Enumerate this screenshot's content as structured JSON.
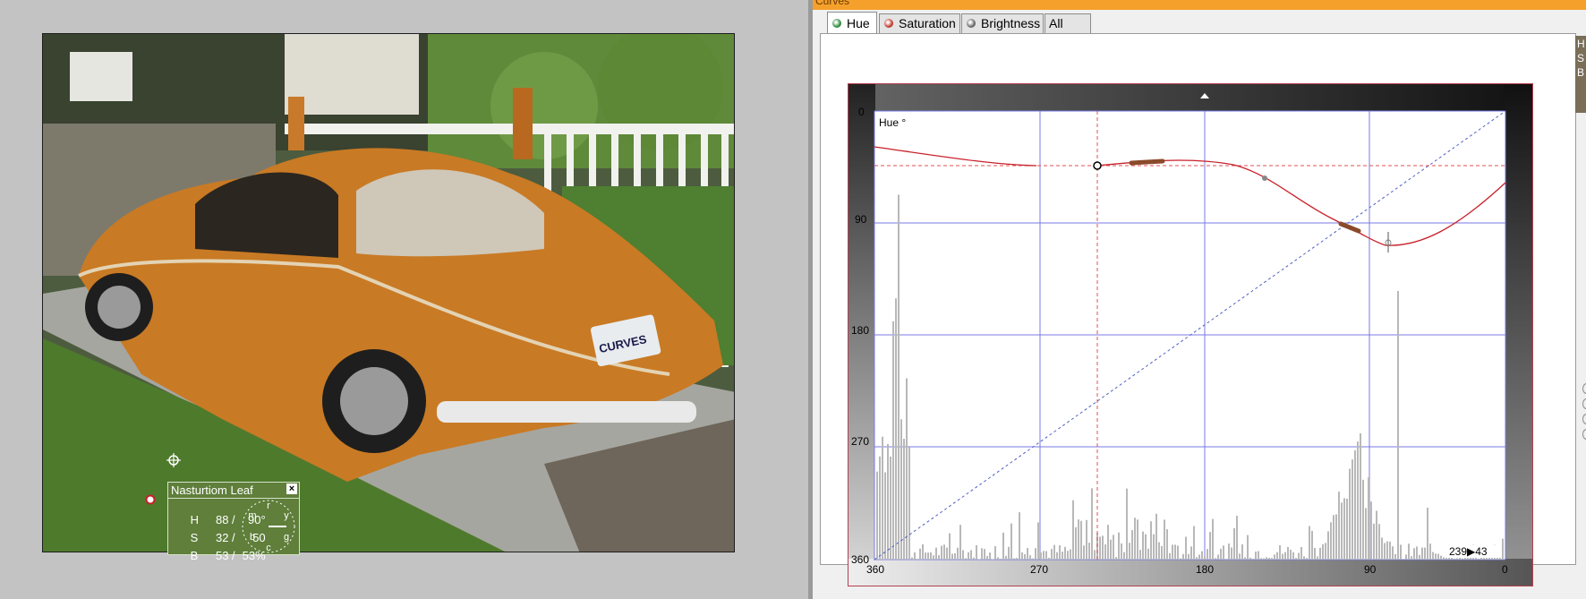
{
  "curves_window": {
    "title": "Curves",
    "tabs": [
      {
        "label": "Hue",
        "active": true,
        "icon": "hue-dot-icon",
        "color": "#2e8b3a"
      },
      {
        "label": "Saturation",
        "active": false,
        "icon": "saturation-dot-icon",
        "color": "#c0392b"
      },
      {
        "label": "Brightness",
        "active": false,
        "icon": "brightness-dot-icon",
        "color": "#666666"
      },
      {
        "label": "All",
        "active": false
      }
    ],
    "graph": {
      "channel_label": "Hue °",
      "y_tick_labels": [
        "0",
        "90",
        "180",
        "270",
        "360"
      ],
      "x_tick_labels": [
        "360",
        "270",
        "180",
        "90",
        "0"
      ],
      "readout": "239▶43",
      "curve_color": "#c8202a",
      "grid_color": "#7a7ae6"
    },
    "side_stub_letters": [
      "H",
      "S",
      "B"
    ]
  },
  "sample_panel": {
    "title": "Nasturtiom Leaf",
    "close_label": "×",
    "rows": [
      {
        "key": "H",
        "v1": "88 /",
        "v2": "90°"
      },
      {
        "key": "S",
        "v1": "32 /",
        "v2": "50"
      },
      {
        "key": "B",
        "v1": "53 /",
        "v2": "53%"
      }
    ],
    "wheel_letters": {
      "r": "r",
      "y": "y",
      "g": "g",
      "c": "c",
      "b": "b",
      "m": "m"
    },
    "fill_color": "#5f7f3b"
  },
  "photo": {
    "plate_text": "CURVES"
  }
}
